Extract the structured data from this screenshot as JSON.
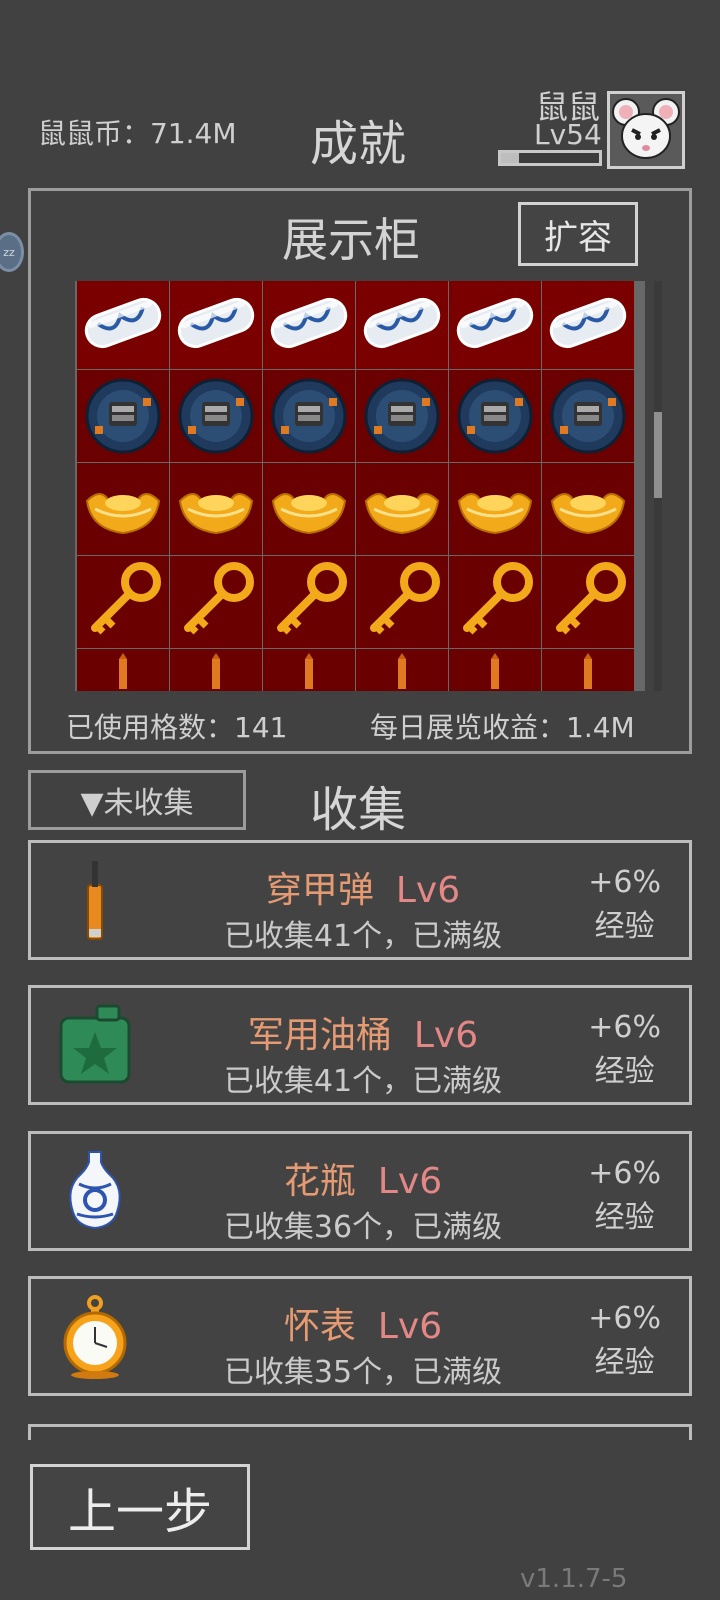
{
  "header": {
    "coins": "鼠鼠币：71.4M",
    "title": "成就",
    "player_name": "鼠鼠",
    "player_level": "Lv54",
    "xp_progress": 0.18
  },
  "side_tab": {
    "label": "zz"
  },
  "cabinet": {
    "title": "展示柜",
    "expand_label": "扩容",
    "rows": [
      "capsule",
      "watch",
      "gold-ingot",
      "gold-key",
      "bullet"
    ],
    "columns": 6,
    "used_cells": "已使用格数：141",
    "daily_income": "每日展览收益：1.4M",
    "scroll_position": 0.3
  },
  "collection": {
    "filter_label": "▼未收集",
    "title": "收集",
    "items": [
      {
        "icon": "bullet-icon",
        "name": "穿甲弹",
        "level": "Lv6",
        "status": "已收集41个，已满级",
        "bonus": "+6%",
        "bonus_type": "经验"
      },
      {
        "icon": "fuel-can-icon",
        "name": "军用油桶",
        "level": "Lv6",
        "status": "已收集41个，已满级",
        "bonus": "+6%",
        "bonus_type": "经验"
      },
      {
        "icon": "vase-icon",
        "name": "花瓶",
        "level": "Lv6",
        "status": "已收集36个，已满级",
        "bonus": "+6%",
        "bonus_type": "经验"
      },
      {
        "icon": "pocket-watch-icon",
        "name": "怀表",
        "level": "Lv6",
        "status": "已收集35个，已满级",
        "bonus": "+6%",
        "bonus_type": "经验"
      }
    ]
  },
  "footer": {
    "back_label": "上一步",
    "version": "v1.1.7-5"
  }
}
